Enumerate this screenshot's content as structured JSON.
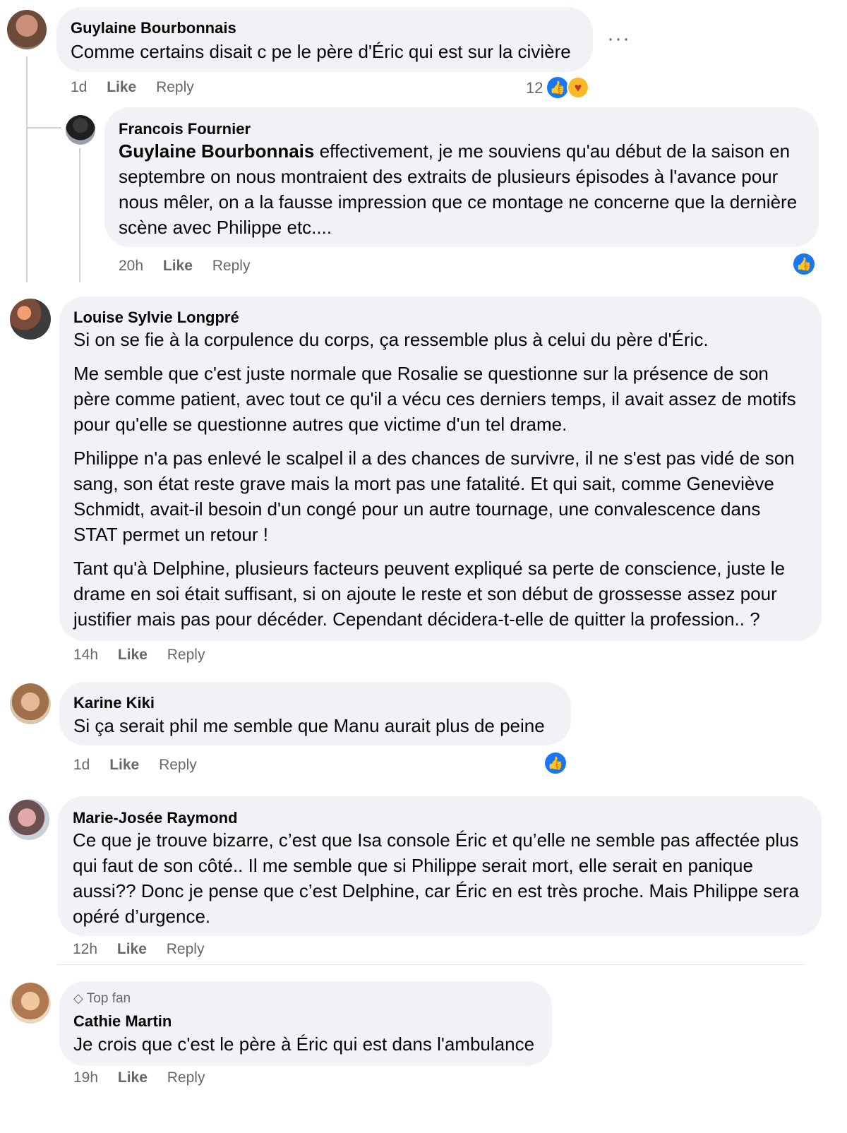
{
  "colors": {
    "bubble": "#f0f2f5",
    "meta": "#65676b",
    "like_blue": "#1877f2",
    "care_yellow": "#f7b928"
  },
  "actions": {
    "like": "Like",
    "reply": "Reply",
    "more": "···"
  },
  "comments": [
    {
      "author": "Guylaine Bourbonnais",
      "paragraphs": [
        "Comme certains disait c pe le père d'Éric qui est sur la civière"
      ],
      "time": "1d",
      "reactions": {
        "count": "12",
        "icons": [
          "like-icon",
          "care-icon"
        ]
      }
    },
    {
      "author": "Francois Fournier",
      "mention": "Guylaine Bourbonnais",
      "paragraphs": [
        " effectivement, je me souviens qu'au début de la saison en septembre on nous montraient des extraits de plusieurs épisodes à l'avance pour nous mêler, on a la fausse impression que ce montage ne concerne que la dernière scène avec Philippe etc...."
      ],
      "time": "20h",
      "reactions": {
        "icons": [
          "like-icon"
        ]
      }
    },
    {
      "author": "Louise Sylvie Longpré",
      "paragraphs": [
        "Si on se fie à la corpulence du corps, ça ressemble plus à celui du père d'Éric.",
        "Me semble que c'est juste normale que Rosalie se questionne sur la présence de son père comme patient, avec tout ce qu'il a vécu ces derniers temps, il avait assez de motifs pour qu'elle se questionne autres que victime d'un tel drame.",
        "Philippe n'a pas enlevé le scalpel il a des chances de survivre, il ne s'est pas vidé de son sang, son état reste grave mais la mort pas une fatalité. Et qui sait, comme Geneviève Schmidt, avait-il besoin d'un congé pour un autre tournage, une convalescence dans STAT permet un retour !",
        "Tant qu'à Delphine, plusieurs facteurs peuvent expliqué sa perte de conscience, juste le drame en soi était suffisant, si on ajoute le reste et son début de grossesse assez pour justifier mais pas pour décéder. Cependant décidera-t-elle de quitter la profession.. ?"
      ],
      "time": "14h"
    },
    {
      "author": "Karine Kiki",
      "paragraphs": [
        "Si ça serait phil me semble que Manu aurait plus de peine"
      ],
      "time": "1d",
      "reactions": {
        "icons": [
          "like-icon"
        ]
      }
    },
    {
      "author": "Marie-Josée Raymond",
      "paragraphs": [
        "Ce que je trouve bizarre, c’est que Isa console Éric et qu’elle ne semble pas affectée plus qui faut de son côté.. Il me semble que si Philippe serait mort, elle serait en panique aussi?? Donc je pense que c’est Delphine, car Éric en est très proche. Mais Philippe sera opéré d’urgence."
      ],
      "time": "12h"
    },
    {
      "badge": "Top fan",
      "author": "Cathie Martin",
      "paragraphs": [
        "Je crois que c'est le père à Éric qui est dans l'ambulance"
      ],
      "time": "19h"
    }
  ]
}
